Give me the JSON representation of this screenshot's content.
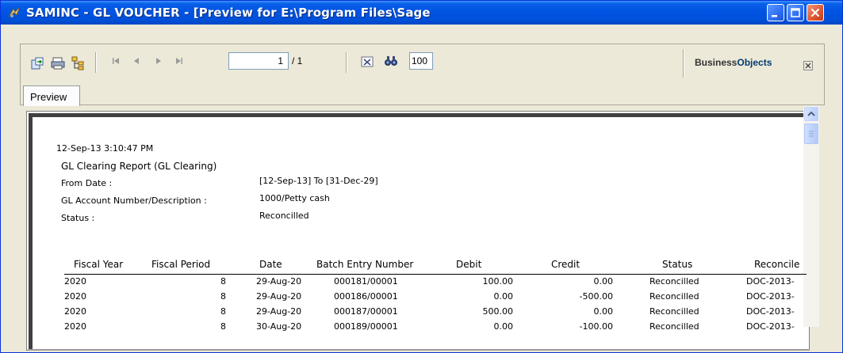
{
  "window": {
    "title": "SAMINC - GL VOUCHER - [Preview for E:\\Program Files\\Sage"
  },
  "toolbar": {
    "page_current": "1",
    "page_total": "/ 1",
    "zoom": "100",
    "brand_part1": "Business",
    "brand_part2": "Objects"
  },
  "tabs": [
    {
      "label": "Preview"
    }
  ],
  "report": {
    "timestamp": "12-Sep-13  3:10:47 PM",
    "title": "GL Clearing Report  (GL Clearing)",
    "from_date_label": "From Date :",
    "from_date_value": "[12-Sep-13]  To  [31-Dec-29]",
    "account_label": "GL Account Number/Description :",
    "account_value": "1000/Petty cash",
    "status_label": "Status :",
    "status_value": "Reconcilled",
    "columns": [
      "Fiscal Year",
      "Fiscal Period",
      "Date",
      "Batch Entry Number",
      "Debit",
      "Credit",
      "Status",
      "Reconcile"
    ],
    "rows": [
      {
        "year": "2020",
        "period": "8",
        "date": "29-Aug-20",
        "batch": "000181/00001",
        "debit": "100.00",
        "credit": "0.00",
        "status": "Reconcilled",
        "doc": "DOC-2013-"
      },
      {
        "year": "2020",
        "period": "8",
        "date": "29-Aug-20",
        "batch": "000186/00001",
        "debit": "0.00",
        "credit": "-500.00",
        "status": "Reconcilled",
        "doc": "DOC-2013-"
      },
      {
        "year": "2020",
        "period": "8",
        "date": "29-Aug-20",
        "batch": "000187/00001",
        "debit": "500.00",
        "credit": "0.00",
        "status": "Reconcilled",
        "doc": "DOC-2013-"
      },
      {
        "year": "2020",
        "period": "8",
        "date": "30-Aug-20",
        "batch": "000189/00001",
        "debit": "0.00",
        "credit": "-100.00",
        "status": "Reconcilled",
        "doc": "DOC-2013-"
      }
    ]
  },
  "colors": {
    "titlebar": "#0054e3",
    "chrome": "#ece9d8",
    "close_button": "#e05a33"
  }
}
